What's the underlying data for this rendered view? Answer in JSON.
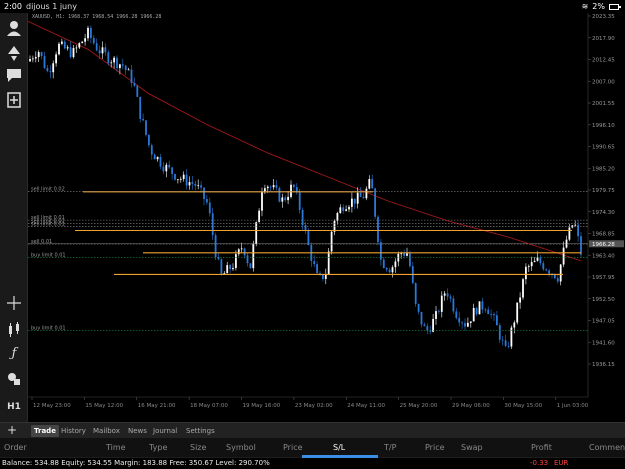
{
  "status_bar": {
    "time": "2:00",
    "date": "dijous 1 juny",
    "battery": "2%"
  },
  "chart": {
    "symbol_info": "XAUUSD, H1:  1968.37 1968.54 1966.28 1966.28",
    "price_labels": [
      "2023.35",
      "2017.90",
      "2012.45",
      "2007.00",
      "2001.55",
      "1996.10",
      "1990.65",
      "1985.20",
      "1979.75",
      "1974.30",
      "1968.85",
      "1963.40",
      "1957.95",
      "1952.50",
      "1947.05",
      "1941.60",
      "1936.15"
    ],
    "current_price": "1966.28",
    "time_labels": [
      "12 May 23:00",
      "15 May 12:00",
      "16 May 21:00",
      "18 May 07:00",
      "19 May 16:00",
      "23 May 02:00",
      "24 May 11:00",
      "25 May 20:00",
      "29 May 06:00",
      "30 May 15:00",
      "1 Jun 03:00"
    ],
    "orders": [
      {
        "label": "sell limit 0.02",
        "kind": "sell",
        "price": 1979.4
      },
      {
        "label": "sell limit 0.01",
        "kind": "sell",
        "price": 1972.2
      },
      {
        "label": "sell limit 0.01",
        "kind": "sell",
        "price": 1971.4
      },
      {
        "label": "sell limit 0.01",
        "kind": "sell",
        "price": 1970.6
      },
      {
        "label": "sell 0.01",
        "kind": "sell",
        "price": 1966.2
      },
      {
        "label": "buy limit 0.01",
        "kind": "buy",
        "price": 1962.8
      },
      {
        "label": "buy limit 0.01",
        "kind": "buy",
        "price": 1944.6
      }
    ],
    "orange_levels": [
      1979.3,
      1969.6,
      1964.0,
      1958.6
    ]
  },
  "tabs": {
    "trade": "Trade",
    "history": "History",
    "mailbox": "Mailbox",
    "news": "News",
    "journal": "Journal",
    "settings": "Settings"
  },
  "columns": {
    "order": "Order",
    "time": "Time",
    "type": "Type",
    "size": "Size",
    "symbol": "Symbol",
    "price": "Price",
    "sl": "S/L",
    "tp": "T/P",
    "price2": "Price",
    "swap": "Swap",
    "profit": "Profit",
    "comment": "Comment"
  },
  "balance": {
    "summary": "Balance: 534.88 Equity: 534.55 Margin: 183.88 Free: 350.67 Level: 290.70%",
    "profit": "-0.33",
    "currency": "EUR"
  },
  "colors": {
    "candle_up": "#ffffff",
    "candle_down": "#2a78d8",
    "ma": "#a0181a",
    "orange": "#f0a030",
    "sell_line": "#8a8a8a",
    "buy_line": "#1a8a4a",
    "current_price_line": "#888888"
  }
}
